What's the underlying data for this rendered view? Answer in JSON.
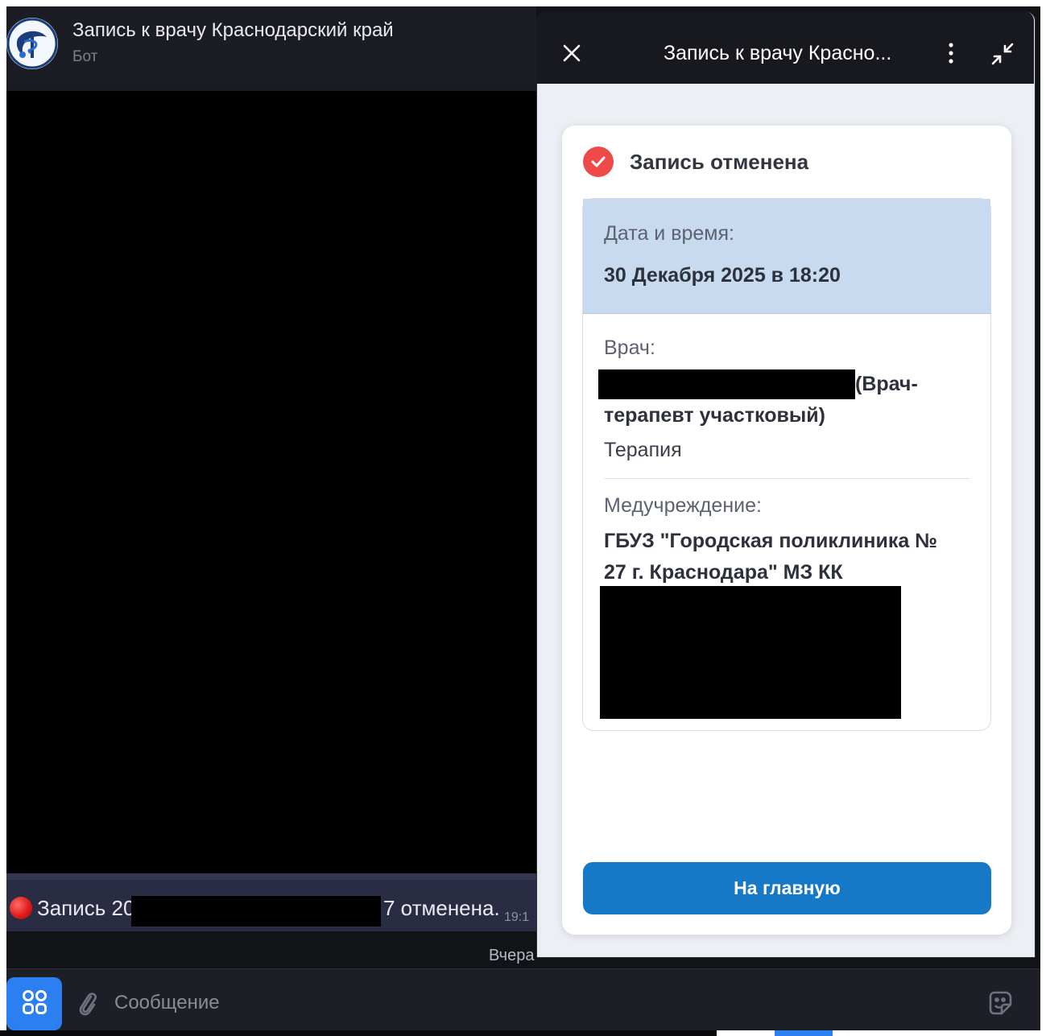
{
  "chat": {
    "title": "Запись к врачу Краснодарский край",
    "subtitle": "Бот",
    "message": {
      "text_left": "Запись 20",
      "text_right": "7 отменена.",
      "time": "19:1"
    },
    "date_separator": "Вчера",
    "composer": {
      "placeholder": "Сообщение"
    }
  },
  "mini_app": {
    "title": "Запись к врачу Красно...",
    "status": "Запись отменена",
    "date_label": "Дата и время:",
    "date_value": "30 Декабря 2025 в 18:20",
    "doctor_label": "Врач:",
    "doctor_spec_line1": "(Врач-",
    "doctor_spec_line2": "терапевт участковый)",
    "department": "Терапия",
    "facility_label": "Медучреждение:",
    "facility_line1": "ГБУЗ \"Городская поликлиника №",
    "facility_line2": "27 г. Краснодара\" МЗ КК",
    "home_button": "На главную"
  },
  "colors": {
    "accent_blue": "#1679c8",
    "status_red": "#ef4a4a",
    "date_block_bg": "#c7daf0"
  },
  "icons": [
    "close-icon",
    "more-vertical-icon",
    "collapse-icon",
    "check-icon",
    "apps-icon",
    "paperclip-icon",
    "sticker-icon"
  ]
}
